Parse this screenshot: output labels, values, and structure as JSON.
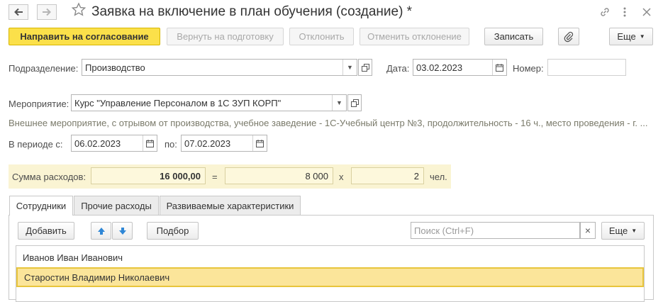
{
  "window": {
    "title": "Заявка на включение в план обучения (создание) *"
  },
  "toolbar": {
    "send_label": "Направить на согласование",
    "return_label": "Вернуть на подготовку",
    "reject_label": "Отклонить",
    "cancel_reject_label": "Отменить отклонение",
    "save_label": "Записать",
    "more_label": "Еще"
  },
  "form": {
    "department_label": "Подразделение:",
    "department_value": "Производство",
    "date_label": "Дата:",
    "date_value": "03.02.2023",
    "number_label": "Номер:",
    "number_value": "",
    "event_label": "Мероприятие:",
    "event_value": "Курс \"Управление Персоналом в 1С ЗУП КОРП\"",
    "event_description": "Внешнее мероприятие, с отрывом от производства, учебное заведение - 1С-Учебный центр №3, продолжительность - 16 ч., место проведения - г. ...",
    "period_label": "В периоде с:",
    "period_from": "06.02.2023",
    "period_to_label": "по:",
    "period_to": "07.02.2023"
  },
  "costs": {
    "label": "Сумма расходов:",
    "total": "16 000,00",
    "equals": "=",
    "per_person": "8 000",
    "times": "x",
    "count": "2",
    "unit": "чел."
  },
  "tabs": [
    {
      "label": "Сотрудники",
      "active": true
    },
    {
      "label": "Прочие расходы",
      "active": false
    },
    {
      "label": "Развиваемые характеристики",
      "active": false
    }
  ],
  "employees_toolbar": {
    "add_label": "Добавить",
    "select_label": "Подбор",
    "search_placeholder": "Поиск (Ctrl+F)",
    "clear_symbol": "×",
    "more_label": "Еще"
  },
  "employees": [
    {
      "name": "Иванов Иван Иванович",
      "selected": false
    },
    {
      "name": "Старостин Владимир Николаевич",
      "selected": true
    }
  ],
  "colors": {
    "primary_button": "#fbe04a",
    "selected_row": "#fbe59a",
    "sum_highlight": "#faf4d3",
    "arrow_blue": "#2f87d6"
  }
}
